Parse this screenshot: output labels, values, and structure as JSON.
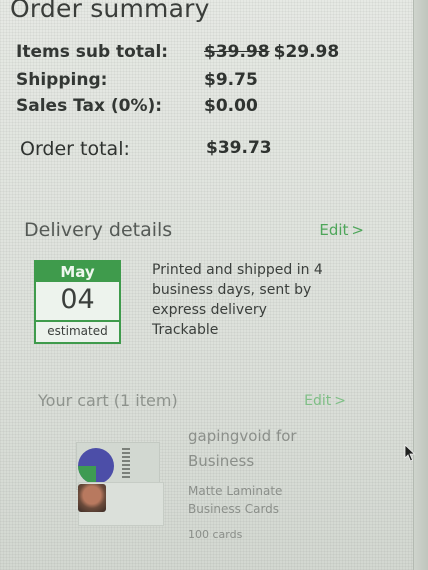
{
  "title": "Order summary",
  "summary": {
    "items_subtotal_label": "Items sub total:",
    "items_subtotal_original": "$39.98",
    "items_subtotal_value": "$29.98",
    "shipping_label": "Shipping:",
    "shipping_value": "$9.75",
    "tax_label": "Sales Tax (0%):",
    "tax_value": "$0.00",
    "order_total_label": "Order total:",
    "order_total_value": "$39.73"
  },
  "delivery": {
    "heading": "Delivery details",
    "edit_label": "Edit",
    "month": "May",
    "day": "04",
    "estimated_label": "estimated",
    "line1": "Printed and shipped in 4",
    "line2": "business days, sent by",
    "line3": "express delivery",
    "line4": "Trackable"
  },
  "cart": {
    "heading": "Your cart (1 item)",
    "edit_label": "Edit",
    "product_line1": "gapingvoid for",
    "product_line2": "Business",
    "material_line1": "Matte Laminate",
    "material_line2": "Business Cards",
    "quantity": "100 cards"
  },
  "icons": {
    "chevron": "chevron-right-icon",
    "cursor": "mouse-pointer-icon"
  },
  "colors": {
    "accent_green": "#3f9b4c",
    "link_green": "#4ea65a"
  }
}
